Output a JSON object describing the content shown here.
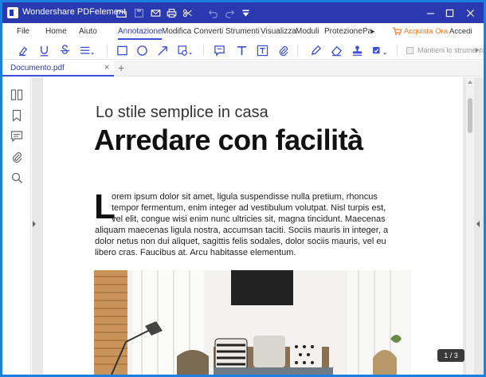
{
  "window": {
    "title": "Wondershare PDFelement"
  },
  "menu": {
    "items": [
      "File",
      "Home",
      "Aiuto",
      "Annotazione",
      "Modifica",
      "Converti",
      "Strumenti",
      "Visualizza",
      "Moduli",
      "Protezione",
      "Pa"
    ],
    "active_index": 3,
    "more_arrow": "▸",
    "cta": "Acquista Ora",
    "login": "Accedi"
  },
  "toolbar": {
    "keep_tools_label": "Mantieni lo strumento selezionato"
  },
  "tabs": {
    "document_name": "Documento.pdf",
    "close_glyph": "×",
    "new_tab_glyph": "+"
  },
  "document": {
    "subtitle": "Lo stile semplice in casa",
    "title": "Arredare con facilità",
    "drop_cap": "L",
    "body_lines": [
      "orem ipsum dolor sit amet, ligula suspendisse nulla pretium, rhoncus",
      "tempor fermentum, enim integer ad vestibulum volutpat. Nisl turpis est,",
      "vel elit, congue wisi enim nunc ultricies sit, magna tincidunt. Maecenas",
      "aliquam maecenas ligula nostra, accumsan taciti. Sociis mauris in integer, a",
      "dolor netus non dui aliquet, sagittis felis sodales, dolor sociis mauris, vel eu",
      "libero cras. Faucibus at. Arcu habitasse elementum."
    ]
  },
  "page_indicator": "1 / 3",
  "colors": {
    "titlebar": "#2b39b0",
    "accent": "#3d4fd6",
    "cta": "#f07a20",
    "desktop": "#1a7fe0"
  }
}
